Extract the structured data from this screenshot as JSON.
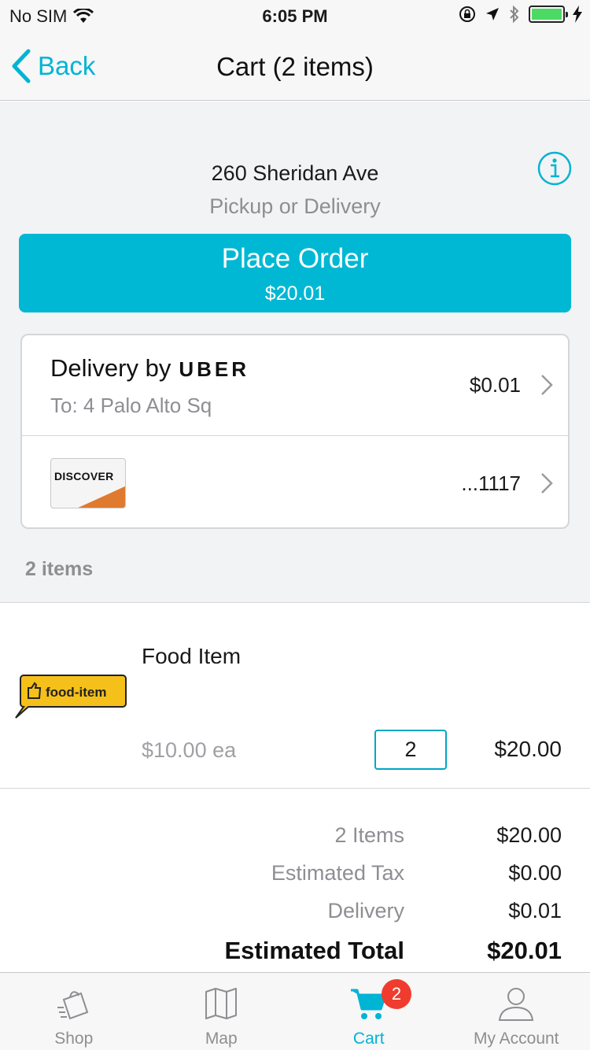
{
  "status_bar": {
    "carrier": "No SIM",
    "time": "6:05 PM"
  },
  "nav": {
    "back_label": "Back",
    "title": "Cart (2 items)"
  },
  "store": {
    "name": "260 Sheridan Ave",
    "mode": "Pickup or Delivery"
  },
  "place_order": {
    "label": "Place Order",
    "amount": "$20.01"
  },
  "delivery": {
    "title_prefix": "Delivery by",
    "provider": "UBER",
    "address": "To: 4 Palo Alto Sq",
    "price": "$0.01"
  },
  "payment": {
    "card_brand": "DISCOVER",
    "last4": "...1117"
  },
  "items_header": "2 items",
  "items": [
    {
      "name": "Food Item",
      "logo_text": "food-item",
      "unit_price": "$10.00 ea",
      "quantity": "2",
      "total": "$20.00"
    }
  ],
  "summary": [
    {
      "label": "2 Items",
      "value": "$20.00"
    },
    {
      "label": "Estimated Tax",
      "value": "$0.00"
    },
    {
      "label": "Delivery",
      "value": "$0.01"
    },
    {
      "label": "Estimated Total",
      "value": "$20.01"
    }
  ],
  "tabs": [
    {
      "label": "Shop",
      "icon": "shopping-bag-icon"
    },
    {
      "label": "Map",
      "icon": "map-icon"
    },
    {
      "label": "Cart",
      "icon": "cart-icon",
      "badge": "2",
      "active": true
    },
    {
      "label": "My Account",
      "icon": "account-icon"
    }
  ],
  "colors": {
    "accent": "#00b8d4",
    "badge": "#f03c2e",
    "battery": "#4cd964"
  }
}
